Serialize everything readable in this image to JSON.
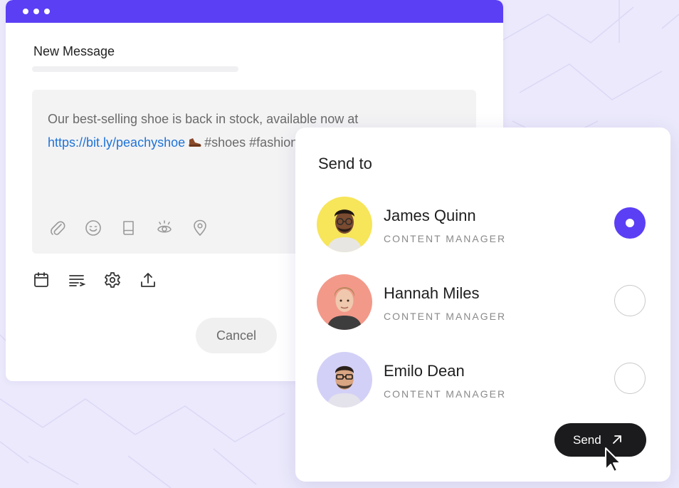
{
  "colors": {
    "accent": "#5b3ff5",
    "background": "#ebe9fb",
    "link": "#1f73d6",
    "send_button": "#1b1b1d"
  },
  "compose": {
    "title": "New Message",
    "message_line1": "Our best-selling shoe is back in stock, available now at",
    "link": "https://bit.ly/peachyshoe",
    "tags": "#shoes #fashion",
    "editor_icons": [
      "paperclip-icon",
      "smile-icon",
      "book-icon",
      "sparkle-icon",
      "location-pin-icon"
    ],
    "toolbar_icons": [
      "calendar-icon",
      "text-wrap-icon",
      "gear-icon",
      "upload-icon"
    ],
    "cancel_label": "Cancel"
  },
  "send_panel": {
    "title": "Send to",
    "contacts": [
      {
        "name": "James Quinn",
        "role": "CONTENT MANAGER",
        "selected": true,
        "avatar_bg": "#f7e55a"
      },
      {
        "name": "Hannah Miles",
        "role": "CONTENT MANAGER",
        "selected": false,
        "avatar_bg": "#f2998a"
      },
      {
        "name": "Emilo Dean",
        "role": "CONTENT MANAGER",
        "selected": false,
        "avatar_bg": "#d3d0f7"
      }
    ],
    "send_label": "Send"
  }
}
